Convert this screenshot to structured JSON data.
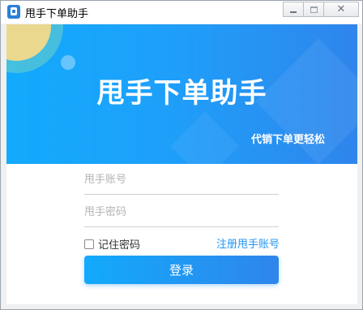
{
  "window": {
    "title": "甩手下单助手",
    "icon": "app-bag-icon",
    "controls": {
      "minimize_icon": "minimize-icon",
      "maximize_icon": "maximize-icon",
      "close_icon": "close-icon",
      "close_glyph": "✕"
    }
  },
  "banner": {
    "title": "甩手下单助手",
    "slogan": "代销下单更轻松",
    "colors": {
      "gradient_start": "#12aafc",
      "gradient_end": "#2f85ec"
    }
  },
  "form": {
    "account_placeholder": "甩手账号",
    "password_placeholder": "甩手密码",
    "remember_label": "记住密码",
    "remember_checked": false,
    "register_link": "注册甩手账号",
    "login_button": "登录"
  },
  "colors": {
    "accent": "#2196f3",
    "button": "#1ea0fa"
  }
}
